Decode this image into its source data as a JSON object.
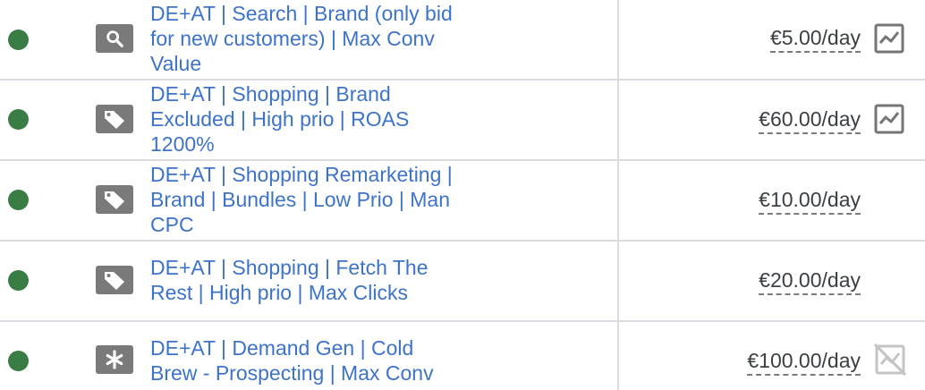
{
  "campaigns": [
    {
      "status": "enabled",
      "type_icon": "search-icon",
      "name": "DE+AT | Search | Brand (only bid for new customers) | Max Conv Value",
      "budget": "€5.00/day",
      "chart_icon": "chart-icon"
    },
    {
      "status": "enabled",
      "type_icon": "shopping-tag-icon",
      "name": "DE+AT | Shopping | Brand Excluded | High prio | ROAS 1200%",
      "budget": "€60.00/day",
      "chart_icon": "chart-icon"
    },
    {
      "status": "enabled",
      "type_icon": "shopping-tag-icon",
      "name": "DE+AT | Shopping Remarketing | Brand | Bundles | Low Prio | Man CPC",
      "budget": "€10.00/day"
    },
    {
      "status": "enabled",
      "type_icon": "shopping-tag-icon",
      "name": "DE+AT | Shopping | Fetch The Rest | High prio | Max Clicks",
      "budget": "€20.00/day"
    },
    {
      "status": "enabled",
      "type_icon": "demand-gen-asterisk-icon",
      "name": "DE+AT | Demand Gen | Cold Brew - Prospecting | Max Conv",
      "budget": "€100.00/day",
      "chart_icon": "chart-disabled-icon"
    }
  ],
  "colors": {
    "status_enabled": "#3a7d44",
    "link": "#3d73c9",
    "icon_bg": "#7a7a7a",
    "divider": "#dadce0"
  }
}
